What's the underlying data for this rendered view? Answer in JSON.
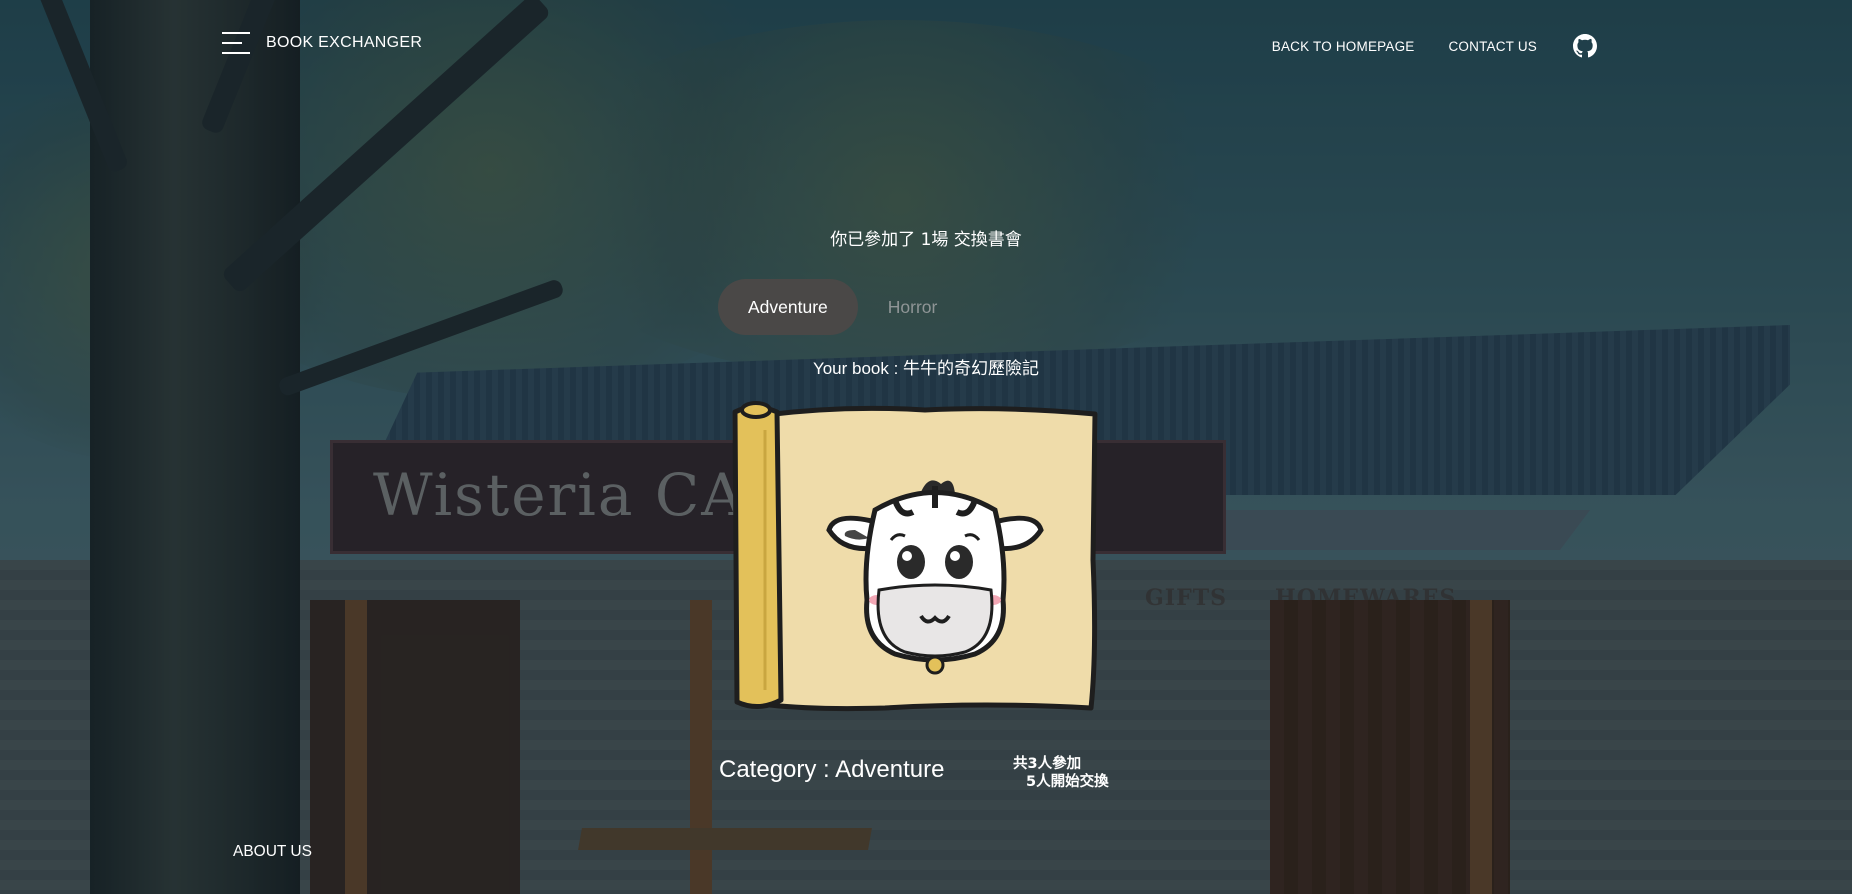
{
  "nav": {
    "brand": "BOOK EXCHANGER",
    "links": [
      "BACK TO HOMEPAGE",
      "CONTACT US"
    ],
    "menu_icon": "hamburger-menu-icon",
    "github_icon": "github-icon"
  },
  "main": {
    "joined_text": "你已參加了 1場 交換書會",
    "tabs": [
      {
        "label": "Adventure",
        "active": true
      },
      {
        "label": "Horror",
        "active": false
      }
    ],
    "your_book": "Your book : 牛牛的奇幻歷險記",
    "category": "Category : Adventure",
    "stats": {
      "line1_prefix": "共",
      "line1_count": "3",
      "line1_suffix": "人參加",
      "line2_count": "5",
      "line2_suffix": "人開始交換"
    }
  },
  "footer": {
    "about": "ABOUT US"
  },
  "colors": {
    "active_tab_bg": "#4a4847",
    "inactive_tab_text": "#8f9596",
    "text": "#ffffff",
    "scroll_paper": "#efdcaa",
    "scroll_roll": "#e3c15a"
  }
}
